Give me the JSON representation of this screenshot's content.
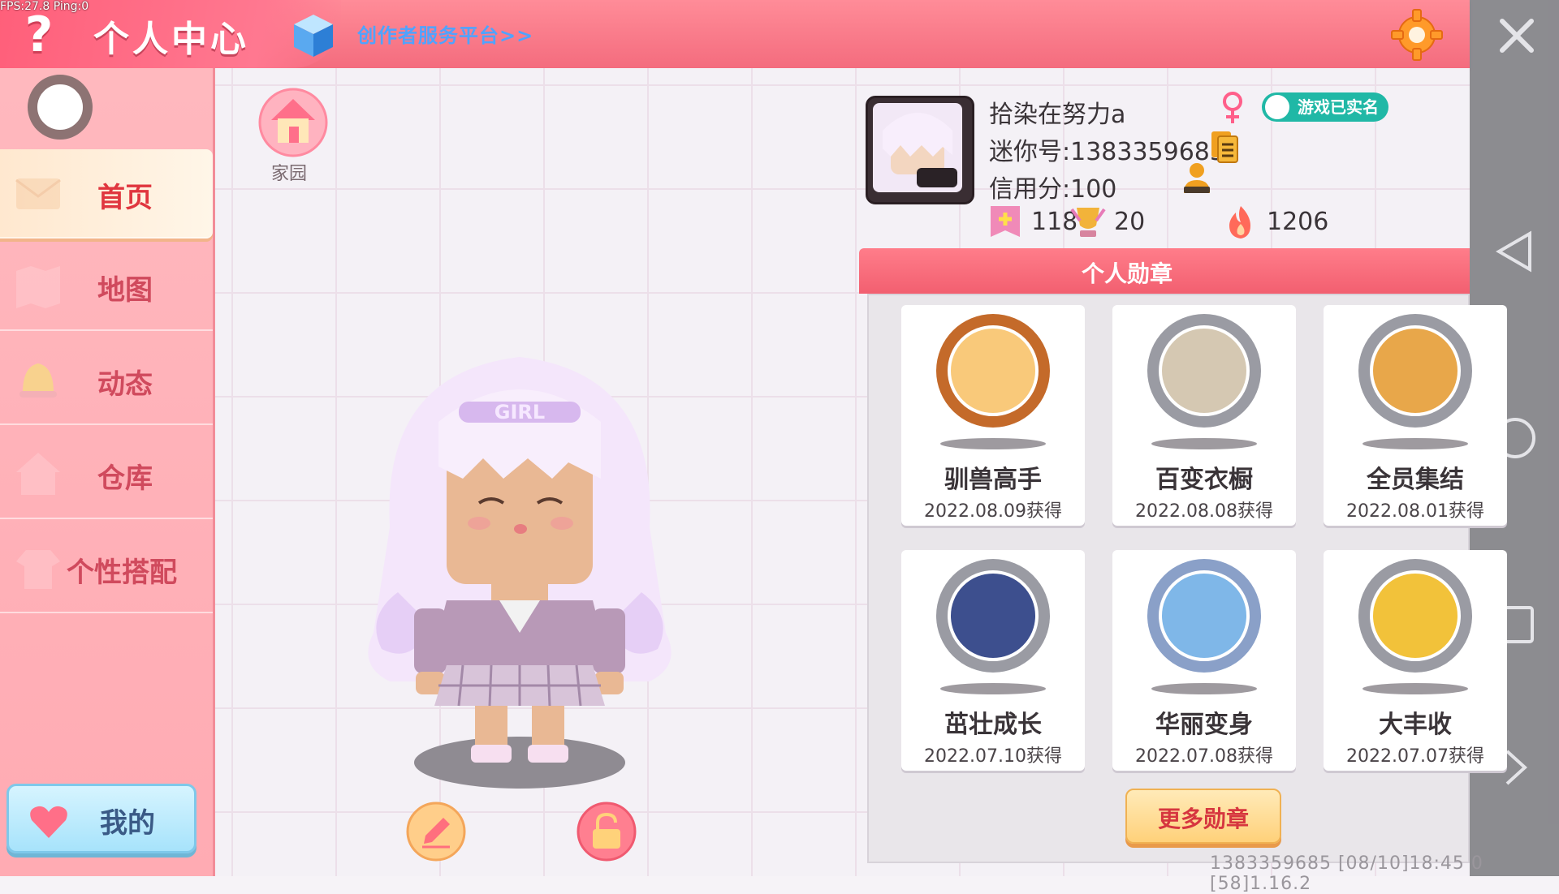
{
  "debug": {
    "fps_text": "FPS:27.8  Ping:0"
  },
  "header": {
    "help_label": "?",
    "title": "个人中心",
    "creator_link": "创作者服务平台>>"
  },
  "sidebar": {
    "items": [
      {
        "label": "首页",
        "active": true
      },
      {
        "label": "地图"
      },
      {
        "label": "动态"
      },
      {
        "label": "仓库"
      },
      {
        "label": "个性搭配"
      }
    ],
    "mine_label": "我的"
  },
  "stage": {
    "home_label": "家园",
    "avatar_hair_text": "GIRL"
  },
  "profile": {
    "name": "拾染在努力a",
    "verified_badge": "游戏已实名",
    "mini_id": "迷你号:1383359685",
    "credit": "信用分:100",
    "stats": [
      {
        "icon": "plus-flag-icon",
        "value": "118"
      },
      {
        "icon": "trophy-icon",
        "value": "20"
      },
      {
        "icon": "flame-icon",
        "value": "1206"
      }
    ]
  },
  "medals": {
    "title": "个人勋章",
    "items": [
      {
        "name": "驯兽高手",
        "date": "2022.08.09获得",
        "ring": "#c46a2a",
        "fill": "#f9c97a"
      },
      {
        "name": "百变衣橱",
        "date": "2022.08.08获得",
        "ring": "#9a9ba3",
        "fill": "#d5c8b2"
      },
      {
        "name": "全员集结",
        "date": "2022.08.01获得",
        "ring": "#9a9ba3",
        "fill": "#e8a74a"
      },
      {
        "name": "茁壮成长",
        "date": "2022.07.10获得",
        "ring": "#9a9ba3",
        "fill": "#3d4f8e"
      },
      {
        "name": "华丽变身",
        "date": "2022.07.08获得",
        "ring": "#8aa0c8",
        "fill": "#7fb7e8"
      },
      {
        "name": "大丰收",
        "date": "2022.07.07获得",
        "ring": "#9a9ba3",
        "fill": "#f2c23a"
      }
    ],
    "more_label": "更多勋章"
  },
  "footer": {
    "text": "1383359685   [08/10]18:45 0   [58]1.16.2"
  },
  "colors": {
    "topbar": "#f46c7e",
    "sidebar": "#ffb0b8",
    "verified": "#20b8a6",
    "more_text": "#d6363f"
  }
}
